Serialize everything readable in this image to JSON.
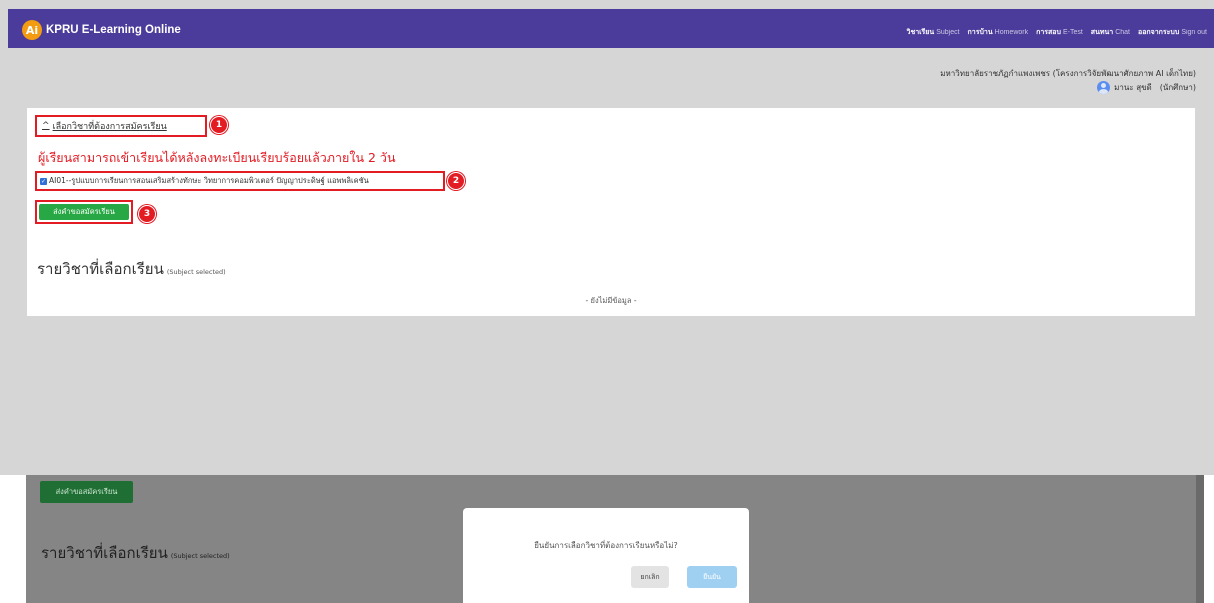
{
  "app": {
    "logo_text": "Ai",
    "title": "KPRU E-Learning Online"
  },
  "nav": [
    {
      "th": "วิชาเรียน",
      "en": "Subject"
    },
    {
      "th": "การบ้าน",
      "en": "Homework"
    },
    {
      "th": "การสอบ",
      "en": "E-Test"
    },
    {
      "th": "สนทนา",
      "en": "Chat"
    },
    {
      "th": "ออกจากระบบ",
      "en": "Sign out"
    }
  ],
  "header": {
    "university": "มหาวิทยาลัยราชภัฏกำแพงเพชร (โครงการวิจัยพัฒนาศักยภาพ AI เด็กไทย)",
    "user_name": "มานะ สุขดี",
    "user_role": "(นักศึกษา)"
  },
  "enroll": {
    "select_link": "เลือกวิชาที่ต้องการสมัครเรียน",
    "notice": "ผู้เรียนสามารถเข้าเรียนได้หลังลงทะเบียนเรียบร้อยแล้วภายใน 2 วัน",
    "course_option": "AI01--รูปแบบการเรียนการสอนเสริมสร้างทักษะ วิทยาการคอมพิวเตอร์ ปัญญาประดิษฐ์ แอพพลิเคชัน",
    "course_checked": true,
    "submit_label": "ส่งคำขอสมัครเรียน",
    "selected_title": "รายวิชาที่เลือกเรียน",
    "selected_sub": "(Subject selected)",
    "empty_text": "- ยังไม่มีข้อมูล -"
  },
  "steps": [
    "1",
    "2",
    "3"
  ],
  "colors": {
    "navbar": "#4b3b9b",
    "accent_red": "#e31b23",
    "success": "#27a844",
    "confirm": "#9fd0f2"
  },
  "modal": {
    "message": "ยืนยันการเลือกวิชาที่ต้องการเรียนหรือไม่?",
    "cancel": "ยกเลิก",
    "confirm": "ยืนยัน"
  }
}
